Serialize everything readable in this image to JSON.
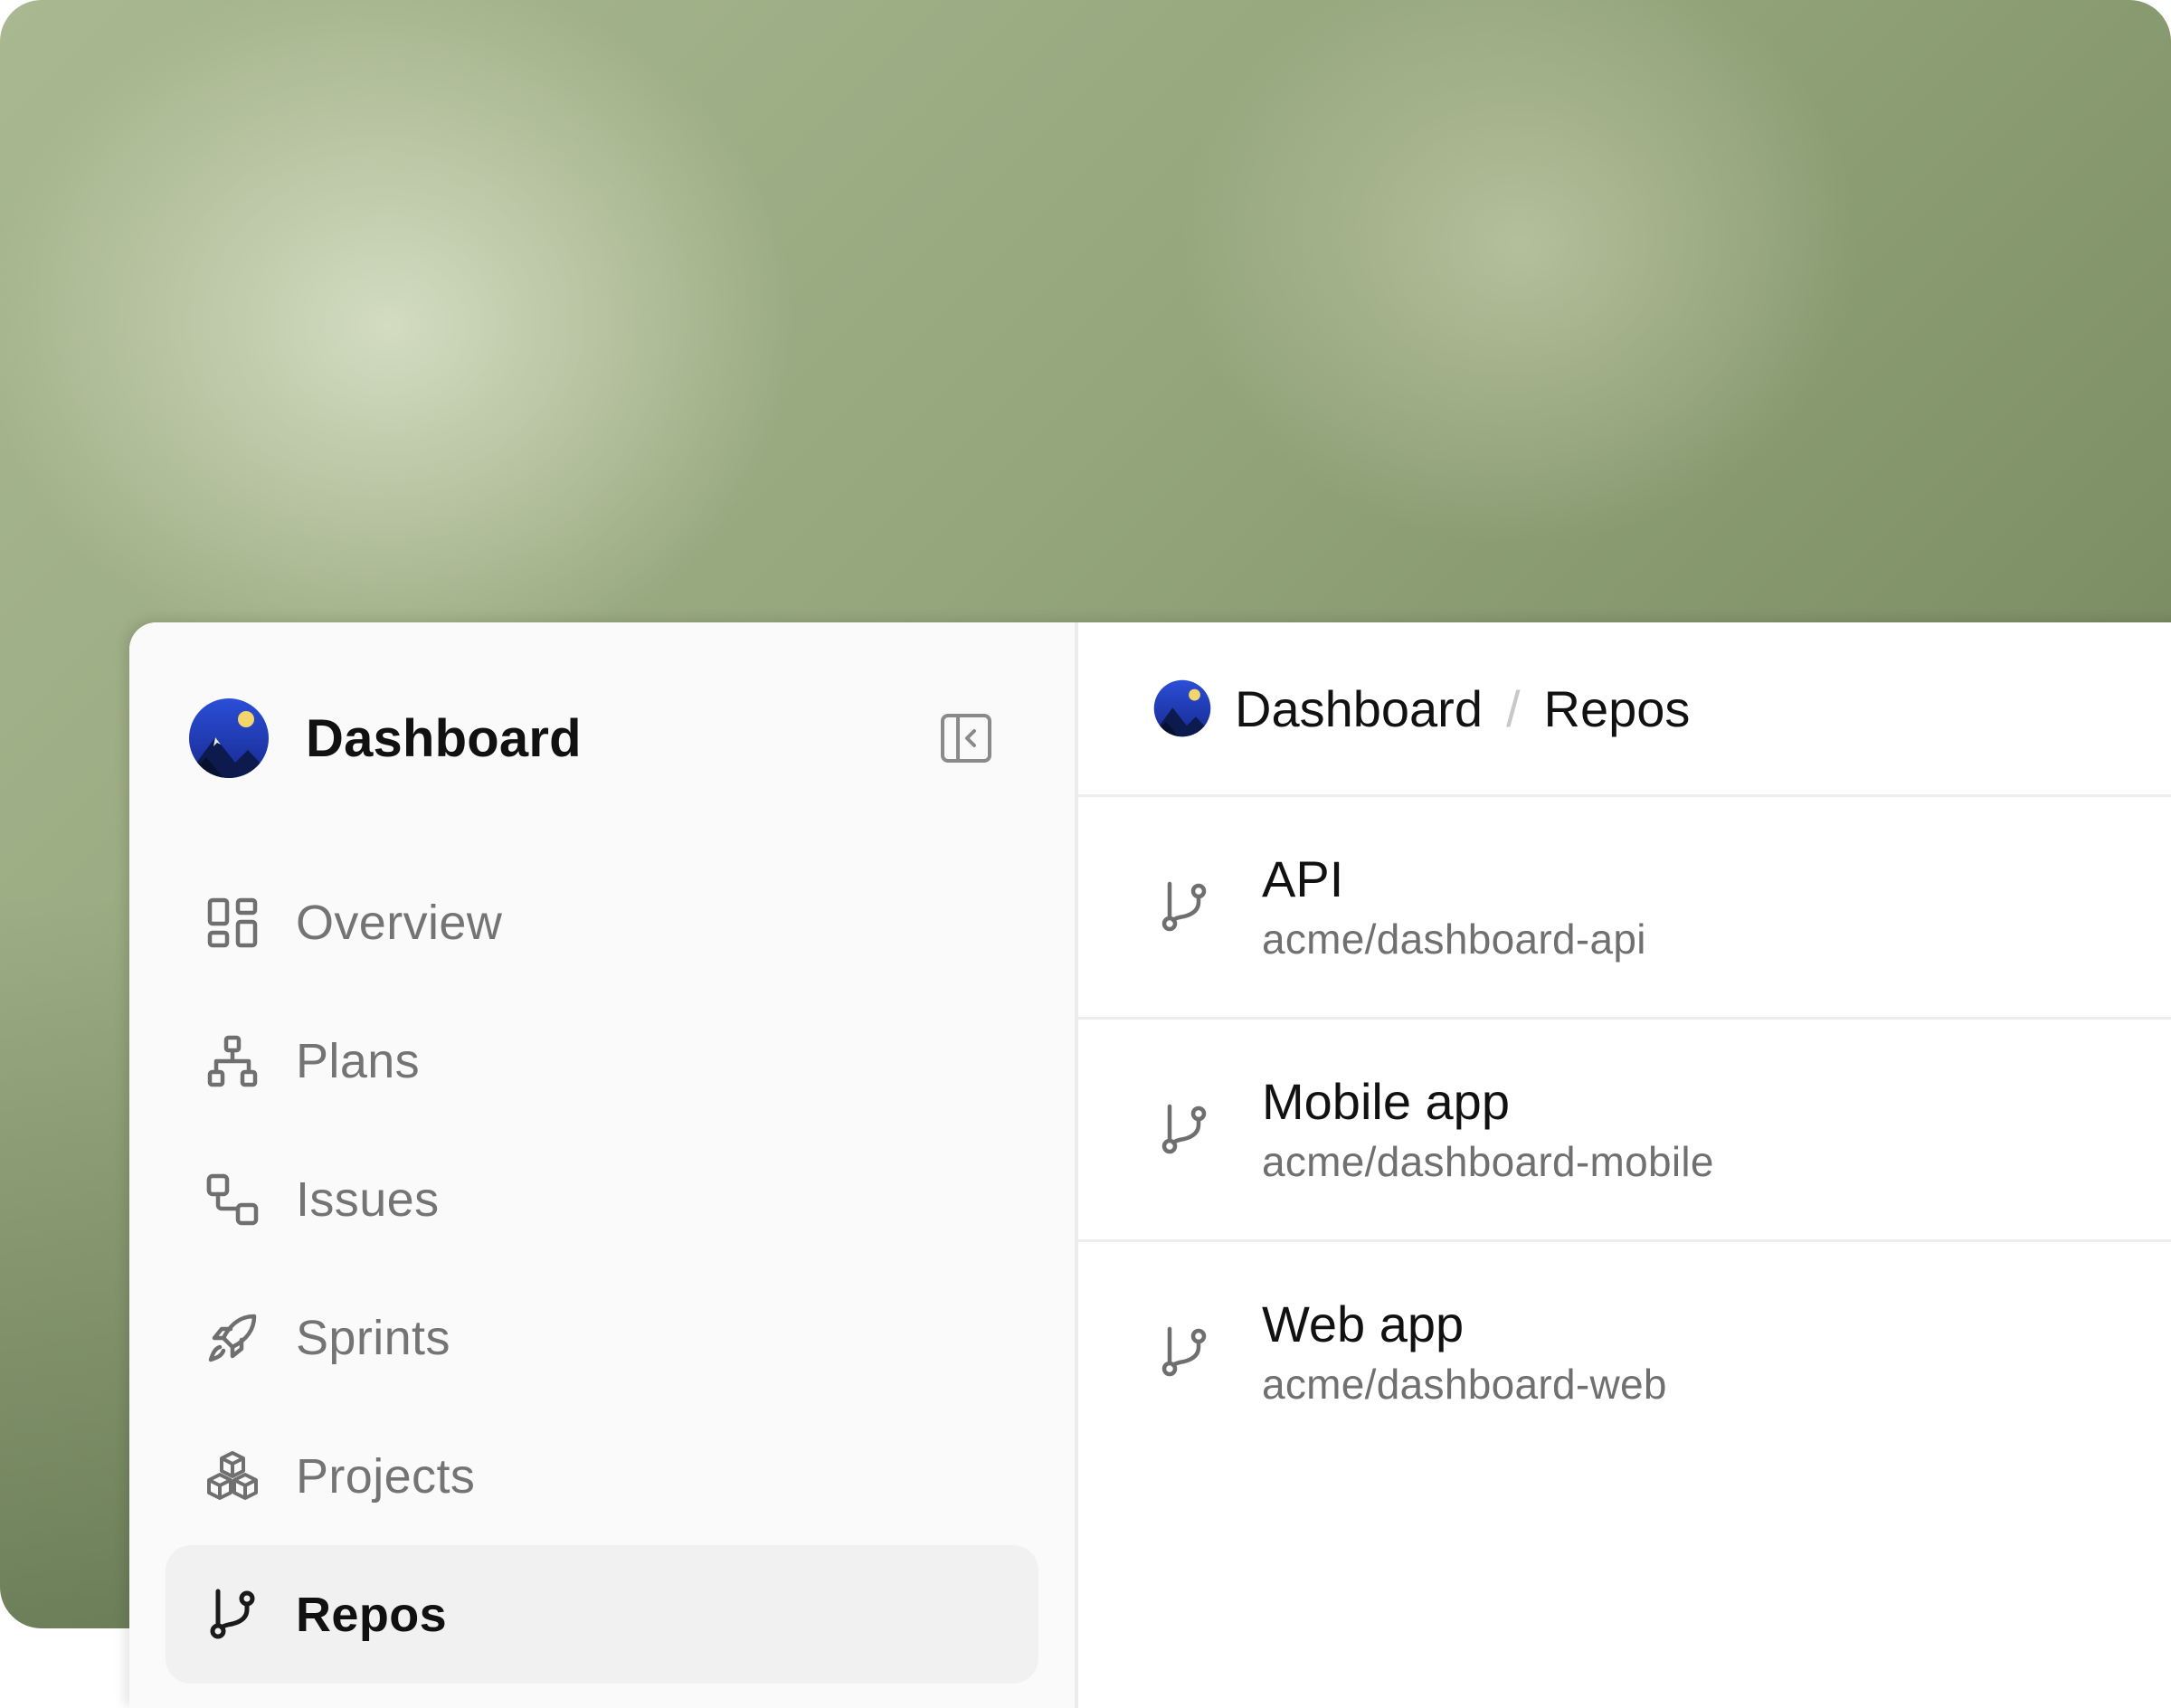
{
  "sidebar": {
    "title": "Dashboard",
    "nav": [
      {
        "label": "Overview",
        "icon": "grid-icon"
      },
      {
        "label": "Plans",
        "icon": "hierarchy-icon"
      },
      {
        "label": "Issues",
        "icon": "linked-squares-icon"
      },
      {
        "label": "Sprints",
        "icon": "rocket-icon"
      },
      {
        "label": "Projects",
        "icon": "cubes-icon"
      },
      {
        "label": "Repos",
        "icon": "git-branch-icon",
        "active": true
      }
    ]
  },
  "breadcrumb": {
    "root": "Dashboard",
    "separator": "/",
    "current": "Repos"
  },
  "repos": [
    {
      "name": "API",
      "path": "acme/dashboard-api"
    },
    {
      "name": "Mobile app",
      "path": "acme/dashboard-mobile"
    },
    {
      "name": "Web app",
      "path": "acme/dashboard-web"
    }
  ],
  "colors": {
    "logo_blue": "#1f3fbf",
    "logo_sun": "#f3d56b",
    "text_primary": "#111111",
    "text_muted": "#747474"
  }
}
